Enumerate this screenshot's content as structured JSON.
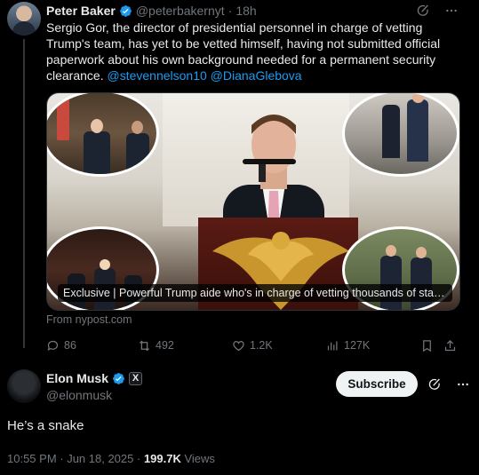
{
  "tweet": {
    "author_name": "Peter Baker",
    "author_handle": "@peterbakernyt",
    "separator": "·",
    "time": "18h",
    "text": "Sergio Gor, the director of presidential personnel in charge of vetting Trump's team, has yet to be vetted himself, having not submitted official paperwork about his own background needed for a permanent security clearance.",
    "mentions": "@stevennelson10 @DianaGlebova",
    "card": {
      "caption": "Exclusive | Powerful Trump aide who's in charge of vetting thousands of staffers...",
      "source": "From nypost.com"
    },
    "actions": {
      "replies": "86",
      "retweets": "492",
      "likes": "1.2K",
      "views": "127K"
    }
  },
  "reply": {
    "author_name": "Elon Musk",
    "author_handle": "@elonmusk",
    "badge_letter": "X",
    "subscribe_label": "Subscribe",
    "text": "He’s a snake",
    "timestamp": "10:55 PM · Jun 18, 2025",
    "meta_separator": " · ",
    "views_count": "199.7K",
    "views_label": "Views"
  },
  "colors": {
    "background": "#000000",
    "text_primary": "#e7e9ea",
    "text_muted": "#71767b",
    "link": "#1d9bf0",
    "verified": "#1d9bf0"
  },
  "icons": [
    "verified-badge-icon",
    "grok-icon",
    "more-icon",
    "reply-icon",
    "retweet-icon",
    "like-icon",
    "views-icon",
    "bookmark-icon",
    "share-icon",
    "x-affiliate-icon"
  ]
}
